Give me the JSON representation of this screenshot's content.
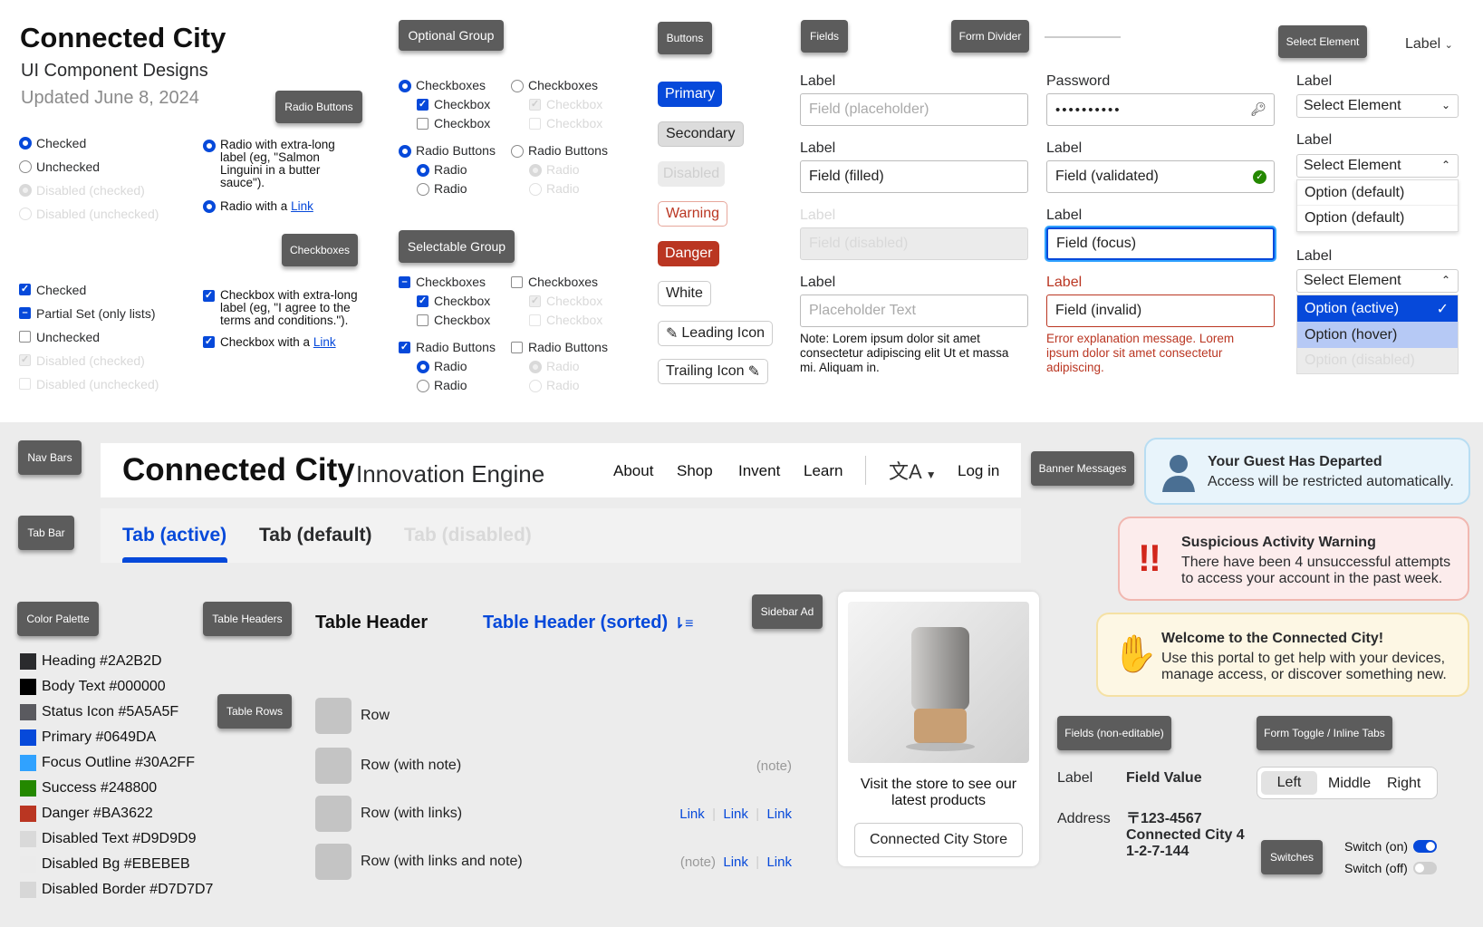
{
  "brand": {
    "title": "Connected City",
    "subtitle": "UI Component Designs",
    "updated": "Updated June 8, 2024"
  },
  "tags": {
    "radio": "Radio Buttons",
    "checkboxes": "Checkboxes",
    "optional": "Optional Group",
    "selectable": "Selectable Group",
    "buttons": "Buttons",
    "fields": "Fields",
    "divider": "Form Divider",
    "select": "Select Element",
    "navbars": "Nav Bars",
    "tabbar": "Tab Bar",
    "palette": "Color Palette",
    "theaders": "Table Headers",
    "trows": "Table Rows",
    "sidebar": "Sidebar Ad",
    "banners": "Banner Messages",
    "noneditable": "Fields (non-editable)",
    "toggle": "Form Toggle / Inline Tabs",
    "switches": "Switches"
  },
  "radios": {
    "checked": "Checked",
    "unchecked": "Unchecked",
    "dchecked": "Disabled (checked)",
    "dunchecked": "Disabled (unchecked)",
    "long": "Radio with extra-long label (eg, \"Salmon Linguini in a butter sauce\").",
    "withlink": "Radio with a",
    "link": "Link"
  },
  "checks": {
    "checked": "Checked",
    "partial": "Partial Set (only lists)",
    "unchecked": "Unchecked",
    "dchecked": "Disabled (checked)",
    "dunchecked": "Disabled (unchecked)",
    "long": "Checkbox with extra-long label (eg, \"I agree to the terms and conditions.\").",
    "withlink": "Checkbox with a",
    "link": "Link"
  },
  "groups": {
    "checkboxes": "Checkboxes",
    "checkbox": "Checkbox",
    "radiobuttons": "Radio Buttons",
    "radio": "Radio"
  },
  "buttons": {
    "primary": "Primary",
    "secondary": "Secondary",
    "disabled": "Disabled",
    "warning": "Warning",
    "danger": "Danger",
    "white": "White",
    "leading": "Leading Icon",
    "trailing": "Trailing Icon"
  },
  "fields": {
    "label": "Label",
    "placeholder": "Field (placeholder)",
    "filled": "Field (filled)",
    "disabled": "Field (disabled)",
    "placeholdertext": "Placeholder Text",
    "note": "Note: Lorem ipsum dolor sit amet consectetur adipiscing elit Ut et massa mi. Aliquam in.",
    "password": "Password",
    "pwdots": "••••••••••",
    "validated": "Field (validated)",
    "focus": "Field (focus)",
    "invalid": "Field (invalid)",
    "error": "Error explanation message. Lorem ipsum dolor sit amet consectetur adipiscing."
  },
  "select": {
    "label": "Label",
    "value": "Select Element",
    "opt": "Option (default)",
    "active": "Option (active)",
    "hover": "Option (hover)",
    "disabled": "Option (disabled)",
    "toplabel": "Label"
  },
  "nav": {
    "brand": "Connected City",
    "sub": "Innovation Engine",
    "about": "About",
    "shop": "Shop",
    "invent": "Invent",
    "learn": "Learn",
    "login": "Log in"
  },
  "tabs": {
    "active": "Tab (active)",
    "default": "Tab (default)",
    "disabled": "Tab (disabled)"
  },
  "palette": [
    {
      "name": "Heading #2A2B2D",
      "color": "#2A2B2D"
    },
    {
      "name": "Body Text #000000",
      "color": "#000000"
    },
    {
      "name": "Status Icon #5A5A5F",
      "color": "#5A5A5F"
    },
    {
      "name": "Primary #0649DA",
      "color": "#0649DA"
    },
    {
      "name": "Focus Outline #30A2FF",
      "color": "#30A2FF"
    },
    {
      "name": "Success #248800",
      "color": "#248800"
    },
    {
      "name": "Danger #BA3622",
      "color": "#BA3622"
    },
    {
      "name": "Disabled Text #D9D9D9",
      "color": "#D9D9D9"
    },
    {
      "name": "Disabled Bg #EBEBEB",
      "color": "#EBEBEB"
    },
    {
      "name": "Disabled Border #D7D7D7",
      "color": "#D7D7D7"
    }
  ],
  "table": {
    "header": "Table Header",
    "sorted": "Table Header (sorted)",
    "row": "Row",
    "rownote": "Row (with note)",
    "rowlinks": "Row (with links)",
    "rowlinksnote": "Row (with links and note)",
    "note": "(note)",
    "link": "Link"
  },
  "ad": {
    "text": "Visit the store to see our latest products",
    "button": "Connected City Store"
  },
  "banners": {
    "t1": "Your Guest Has Departed",
    "b1": "Access will be restricted automatically.",
    "t2": "Suspicious Activity Warning",
    "b2": "There have been 4 unsuccessful attempts to access your account in the past week.",
    "t3": "Welcome to the Connected City!",
    "b3": "Use this portal to get help with your devices, manage access, or discover something new."
  },
  "noneditable": {
    "label": "Label",
    "value": "Field Value",
    "addrlabel": "Address",
    "addr1": "〒123-4567",
    "addr2": "Connected City 4",
    "addr3": "1-2-7-144"
  },
  "toggle": {
    "left": "Left",
    "middle": "Middle",
    "right": "Right"
  },
  "switches": {
    "on": "Switch (on)",
    "off": "Switch (off)"
  }
}
